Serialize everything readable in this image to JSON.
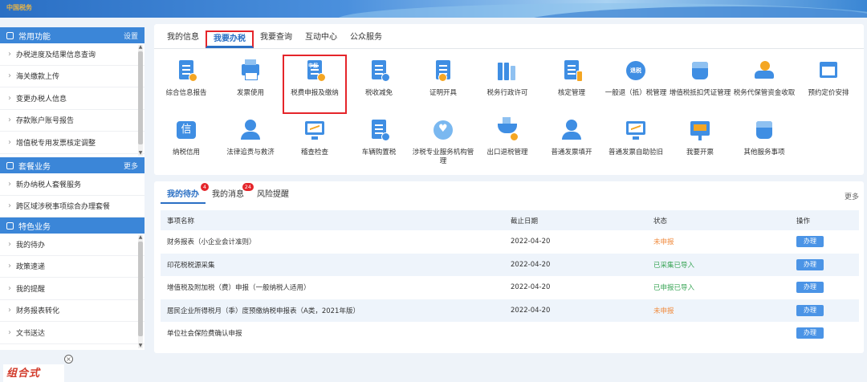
{
  "banner": {
    "logo_text": "中国税务"
  },
  "sidebar": {
    "common": {
      "title": "常用功能",
      "more": "设置",
      "items": [
        "办税进度及结果信息查询",
        "海关缴款上传",
        "变更办税人信息",
        "存款账户账号报告",
        "增值税专用发票核定调整"
      ]
    },
    "package": {
      "title": "套餐业务",
      "more": "更多",
      "items": [
        "新办纳税人套餐服务",
        "跨区域涉税事项综合办理套餐"
      ]
    },
    "special": {
      "title": "特色业务",
      "items": [
        "我的待办",
        "政策速递",
        "我的提醒",
        "财务报表转化",
        "文书送达"
      ]
    },
    "float_banner": "组合式"
  },
  "top": {
    "tabs": [
      "我的信息",
      "我要办税",
      "我要查询",
      "互动中心",
      "公众服务"
    ],
    "active_tab": 1,
    "row1": [
      "综合信息报告",
      "发票使用",
      "税费申报及缴纳",
      "税收减免",
      "证明开具",
      "税务行政许可",
      "核定管理",
      "一般退（抵）税管理",
      "增值税抵扣凭证管理",
      "税务代保管资金收取",
      "预约定价安排"
    ],
    "row2": [
      "纳税信用",
      "法律追责与救济",
      "稽查检查",
      "车辆购置税",
      "涉税专业服务机构管理",
      "出口退税管理",
      "普通发票填开",
      "普通发票自助验旧",
      "我要开票",
      "其他服务事项"
    ],
    "icon_texts": {
      "declare": "申报",
      "refund": "退税",
      "credit": "信"
    }
  },
  "bottom": {
    "tabs": [
      {
        "label": "我的待办",
        "count": "4"
      },
      {
        "label": "我的消息",
        "count": "24"
      },
      {
        "label": "风险提醒",
        "count": ""
      }
    ],
    "more": "更多",
    "headers": [
      "事项名称",
      "截止日期",
      "状态",
      "操作"
    ],
    "rows": [
      {
        "name": "财务报表（小企业会计准则）",
        "date": "2022-04-20",
        "status": "未申报",
        "status_type": "red",
        "action": "办理"
      },
      {
        "name": "印花税税源采集",
        "date": "2022-04-20",
        "status": "已采集已导入",
        "status_type": "green",
        "action": "办理"
      },
      {
        "name": "增值税及附加税（费）申报（一般纳税人适用）",
        "date": "2022-04-20",
        "status": "已申报已导入",
        "status_type": "green",
        "action": "办理"
      },
      {
        "name": "居民企业所得税月（季）度预缴纳税申报表（A类，2021年版）",
        "date": "2022-04-20",
        "status": "未申报",
        "status_type": "red",
        "action": "办理"
      },
      {
        "name": "单位社会保险费确认申报",
        "date": "",
        "status": "",
        "status_type": "",
        "action": "办理"
      }
    ]
  },
  "colors": {
    "primary": "#3b86d8",
    "highlight": "#e5252a",
    "warn": "#f08a3c",
    "ok": "#3aa557"
  }
}
